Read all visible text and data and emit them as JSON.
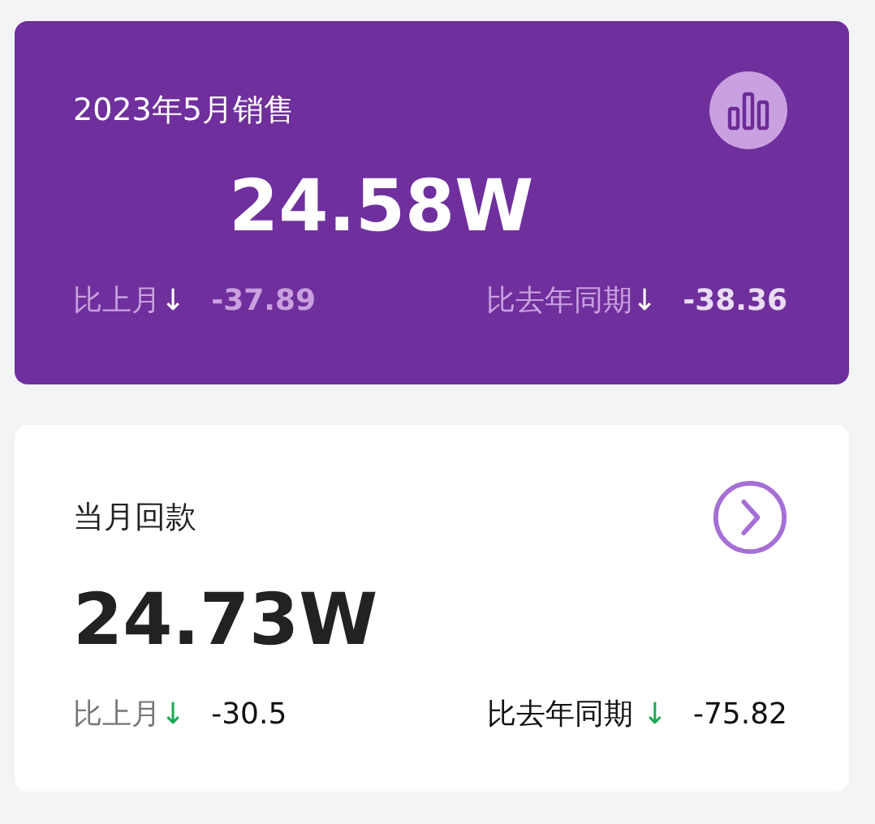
{
  "cards": [
    {
      "kind": "primary",
      "title": "2023年5月销售",
      "value": "24.58W",
      "comparisons": [
        {
          "label": "比上月",
          "arrow": "↓",
          "value": "-37.89"
        },
        {
          "label": "比去年同期",
          "arrow": "↓",
          "value": "-38.36"
        }
      ]
    },
    {
      "kind": "plain",
      "title": "当月回款",
      "value": "24.73W",
      "comparisons": [
        {
          "label": "比上月",
          "arrow": "↓",
          "value": "-30.5"
        },
        {
          "label": "比去年同期",
          "arrow": "↓",
          "value": "-75.82"
        }
      ]
    }
  ]
}
